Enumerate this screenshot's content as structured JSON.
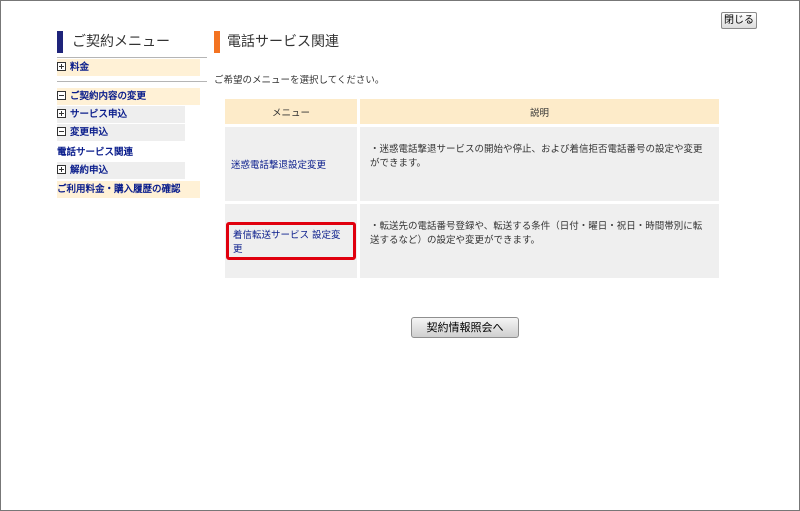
{
  "header": {
    "close_label": "閉じる"
  },
  "sidebar": {
    "title": "ご契約メニュー",
    "items": [
      {
        "label": "料金",
        "toggle": "plus"
      },
      {
        "label": "ご契約内容の変更",
        "toggle": "minus"
      },
      {
        "label": "サービス申込",
        "toggle": "plus"
      },
      {
        "label": "変更申込",
        "toggle": "minus"
      },
      {
        "label": "電話サービス関連",
        "toggle": "none"
      },
      {
        "label": "解約申込",
        "toggle": "plus"
      },
      {
        "label": "ご利用料金・購入履歴の確認",
        "toggle": "none"
      }
    ]
  },
  "main": {
    "title": "電話サービス関連",
    "instruction": "ご希望のメニューを選択してください。",
    "table": {
      "headers": [
        "メニュー",
        "説明"
      ],
      "rows": [
        {
          "menu": "迷惑電話撃退設定変更",
          "description": "・迷惑電話撃退サービスの開始や停止、および着信拒否電話番号の設定や変更ができます。"
        },
        {
          "menu": "着信転送サービス 設定変更",
          "description": "・転送先の電話番号登録や、転送する条件（日付・曜日・祝日・時間帯別に転送するなど）の設定や変更ができます。"
        }
      ]
    },
    "action_button": "契約情報照会へ"
  },
  "colors": {
    "navy_accent": "#1e237a",
    "orange_accent": "#f37321",
    "link": "#0a1d8c",
    "header_cell": "#fdebc9",
    "highlight_border": "#e0000e"
  }
}
